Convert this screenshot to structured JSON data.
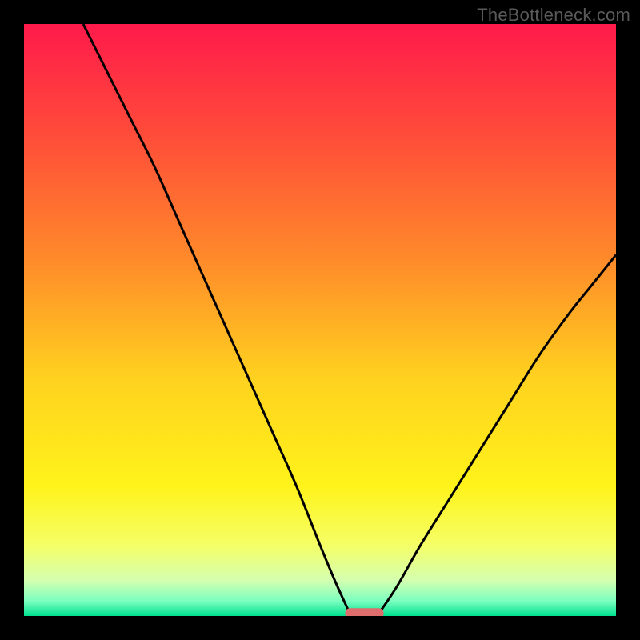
{
  "watermark": "TheBottleneck.com",
  "colors": {
    "frame_bg": "#000000",
    "watermark": "#5a5a5a",
    "curve": "#000000",
    "marker_fill": "#de6e6d",
    "gradient_stops": [
      {
        "offset": 0.0,
        "color": "#ff1a4b"
      },
      {
        "offset": 0.18,
        "color": "#ff4a3a"
      },
      {
        "offset": 0.4,
        "color": "#ff8b2a"
      },
      {
        "offset": 0.6,
        "color": "#ffd21f"
      },
      {
        "offset": 0.78,
        "color": "#fff31a"
      },
      {
        "offset": 0.88,
        "color": "#f5ff66"
      },
      {
        "offset": 0.94,
        "color": "#d4ffb0"
      },
      {
        "offset": 0.975,
        "color": "#7affc0"
      },
      {
        "offset": 1.0,
        "color": "#00e08e"
      }
    ]
  },
  "chart_data": {
    "type": "line",
    "title": "",
    "xlabel": "",
    "ylabel": "",
    "xlim": [
      0,
      100
    ],
    "ylim": [
      0,
      100
    ],
    "grid": false,
    "legend": false,
    "annotations": [],
    "series": [
      {
        "name": "left-branch",
        "x": [
          10,
          14,
          18,
          22,
          26,
          30,
          34,
          38,
          42,
          46,
          50,
          52.5,
          55
        ],
        "y": [
          100,
          92,
          84,
          76,
          67,
          58,
          49,
          40,
          31,
          22,
          12,
          6,
          0.5
        ]
      },
      {
        "name": "right-branch",
        "x": [
          60,
          63,
          67,
          72,
          77,
          82,
          87,
          92,
          96,
          100
        ],
        "y": [
          0.5,
          5,
          12,
          20,
          28,
          36,
          44,
          51,
          56,
          61
        ]
      }
    ],
    "marker": {
      "x_center": 57.5,
      "width": 6.5,
      "y": 0.5
    }
  }
}
